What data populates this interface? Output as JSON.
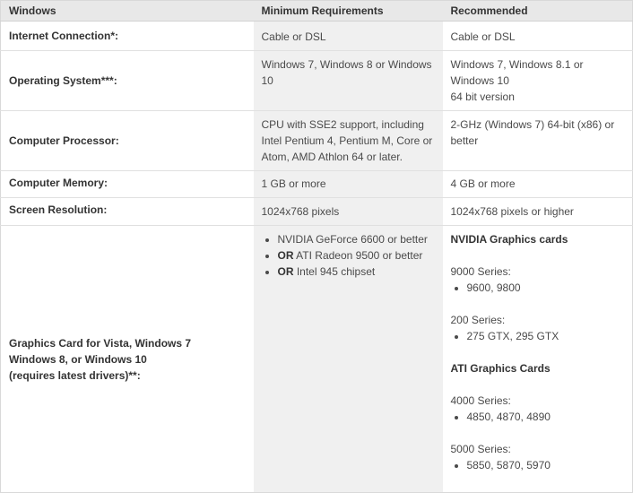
{
  "table": {
    "headers": [
      "Windows",
      "Minimum Requirements",
      "Recommended"
    ],
    "rows": {
      "internet": {
        "label": "Internet Connection*:",
        "min": "Cable or DSL",
        "rec": "Cable or DSL"
      },
      "os": {
        "label": "Operating System***:",
        "min": "Windows 7, Windows 8 or Windows 10",
        "rec_line1": "Windows 7, Windows 8.1 or Windows 10",
        "rec_line2": "64 bit version"
      },
      "processor": {
        "label": "Computer Processor:",
        "min": "CPU with SSE2 support, including Intel Pentium 4, Pentium M, Core or Atom, AMD Athlon 64 or later.",
        "rec": "2-GHz (Windows 7) 64-bit (x86) or better"
      },
      "memory": {
        "label": "Computer Memory:",
        "min": "1 GB or more",
        "rec": "4 GB or more"
      },
      "resolution": {
        "label": "Screen Resolution:",
        "min": "1024x768 pixels",
        "rec": "1024x768 pixels or higher"
      },
      "graphics": {
        "label_line1": "Graphics Card for Vista, Windows 7",
        "label_line2": "Windows 8, or Windows 10",
        "label_line3": "(requires latest drivers)**:",
        "min_items": [
          {
            "prefix": "",
            "text": "NVIDIA GeForce 6600 or better"
          },
          {
            "prefix": "OR",
            "text": " ATI Radeon 9500 or better"
          },
          {
            "prefix": "OR",
            "text": " Intel 945 chipset"
          }
        ],
        "rec": {
          "nvidia_heading": "NVIDIA Graphics cards",
          "nvidia_9000_label": "9000 Series:",
          "nvidia_9000_models": "9600, 9800",
          "nvidia_200_label": "200 Series:",
          "nvidia_200_models": "275 GTX, 295 GTX",
          "ati_heading": "ATI Graphics Cards",
          "ati_4000_label": "4000 Series:",
          "ati_4000_models": "4850, 4870, 4890",
          "ati_5000_label": "5000 Series:",
          "ati_5000_models": "5850, 5870, 5970"
        }
      }
    }
  }
}
